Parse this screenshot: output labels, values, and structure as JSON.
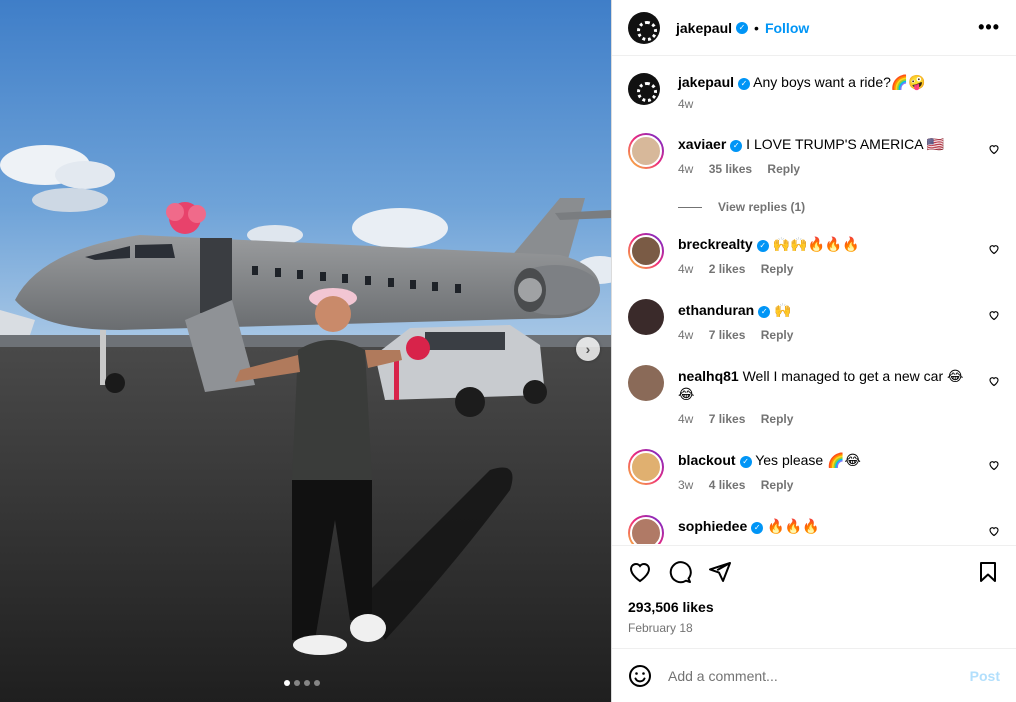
{
  "post": {
    "author": "jakepaul",
    "follow_label": "Follow",
    "separator": "•",
    "more_label": "•••",
    "caption": "Any boys want a ride?🌈🤪",
    "caption_age": "4w",
    "likes": "293,506 likes",
    "date": "February 18"
  },
  "comments": [
    {
      "user": "xaviaer",
      "verified": true,
      "text": "I LOVE TRUMP'S AMERICA 🇺🇸",
      "age": "4w",
      "likes": "35 likes",
      "reply": "Reply"
    },
    {
      "user": "breckrealty",
      "verified": true,
      "text": "🙌🙌🔥🔥🔥",
      "age": "4w",
      "likes": "2 likes",
      "reply": "Reply"
    },
    {
      "user": "ethanduran",
      "verified": true,
      "text": "🙌",
      "age": "4w",
      "likes": "7 likes",
      "reply": "Reply"
    },
    {
      "user": "nealhq81",
      "verified": false,
      "text": "Well I managed to get a new car 😂😂",
      "age": "4w",
      "likes": "7 likes",
      "reply": "Reply"
    },
    {
      "user": "blackout",
      "verified": true,
      "text": "Yes please 🌈😂",
      "age": "3w",
      "likes": "4 likes",
      "reply": "Reply"
    },
    {
      "user": "sophiedee",
      "verified": true,
      "text": "🔥🔥🔥"
    }
  ],
  "view_replies": "View replies (1)",
  "add_comment": {
    "placeholder": "Add a comment...",
    "post_label": "Post"
  },
  "carousel": {
    "current": 1,
    "total": 4,
    "next_label": "›"
  },
  "colors": {
    "accent": "#0095f6",
    "muted": "#737373",
    "post_disabled": "#b2dffc"
  }
}
